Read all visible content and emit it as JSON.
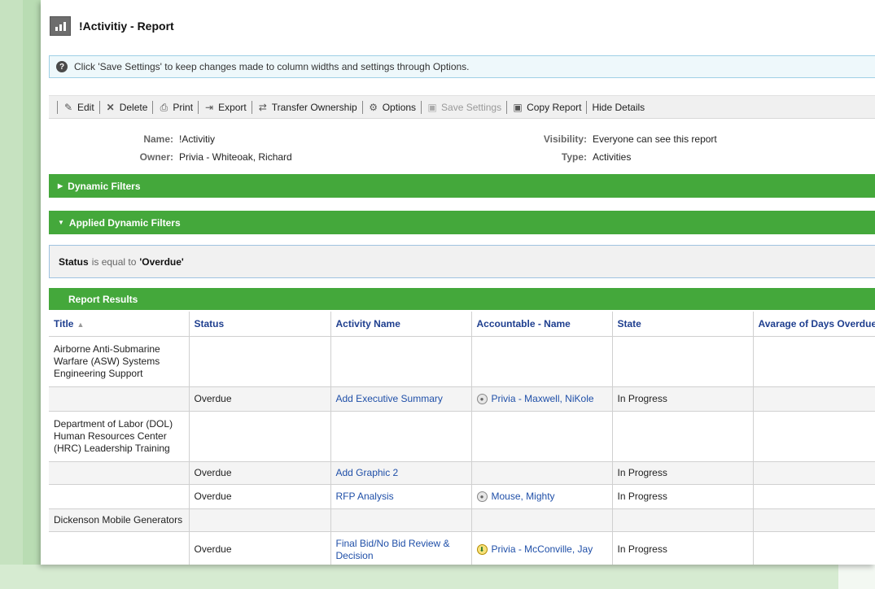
{
  "title": "!Activitiy - Report",
  "info_message": "Click 'Save Settings' to keep changes made to column widths and settings through Options.",
  "toolbar": {
    "edit": "Edit",
    "delete": "Delete",
    "print": "Print",
    "export": "Export",
    "transfer": "Transfer Ownership",
    "options": "Options",
    "save_settings": "Save Settings",
    "copy_report": "Copy Report",
    "hide_details": "Hide Details"
  },
  "meta": {
    "name_label": "Name:",
    "name_value": "!Activitiy",
    "owner_label": "Owner:",
    "owner_value": "Privia - Whiteoak, Richard",
    "visibility_label": "Visibility:",
    "visibility_value": "Everyone can see this report",
    "type_label": "Type:",
    "type_value": "Activities"
  },
  "sections": {
    "dynamic_filters": "Dynamic Filters",
    "applied_filters": "Applied Dynamic Filters",
    "report_results": "Report Results"
  },
  "filter": {
    "field": "Status",
    "operator": "is equal to",
    "value": "'Overdue'"
  },
  "table": {
    "columns": [
      "Title",
      "Status",
      "Activity Name",
      "Accountable - Name",
      "State",
      "Avarage of Days Overdue"
    ],
    "rows": [
      {
        "title": "Airborne Anti-Submarine Warfare (ASW) Systems Engineering Support",
        "status": "",
        "activity": "",
        "accountable": "",
        "state": "",
        "days": ""
      },
      {
        "title": "",
        "status": "Overdue",
        "activity": "Add Executive Summary",
        "accountable": "Privia - Maxwell, NiKole",
        "state": "In Progress",
        "days": ""
      },
      {
        "title": "Department of Labor (DOL) Human Resources Center (HRC) Leadership Training",
        "status": "",
        "activity": "",
        "accountable": "",
        "state": "",
        "days": ""
      },
      {
        "title": "",
        "status": "Overdue",
        "activity": "Add Graphic 2",
        "accountable": "",
        "state": "In Progress",
        "days": ""
      },
      {
        "title": "",
        "status": "Overdue",
        "activity": "RFP Analysis",
        "accountable": "Mouse, Mighty",
        "state": "In Progress",
        "days": ""
      },
      {
        "title": "Dickenson Mobile Generators",
        "status": "",
        "activity": "",
        "accountable": "",
        "state": "",
        "days": ""
      },
      {
        "title": "",
        "status": "Overdue",
        "activity": "Final Bid/No Bid Review & Decision",
        "accountable": "Privia - McConville, Jay",
        "state": "In Progress",
        "days": ""
      }
    ]
  }
}
